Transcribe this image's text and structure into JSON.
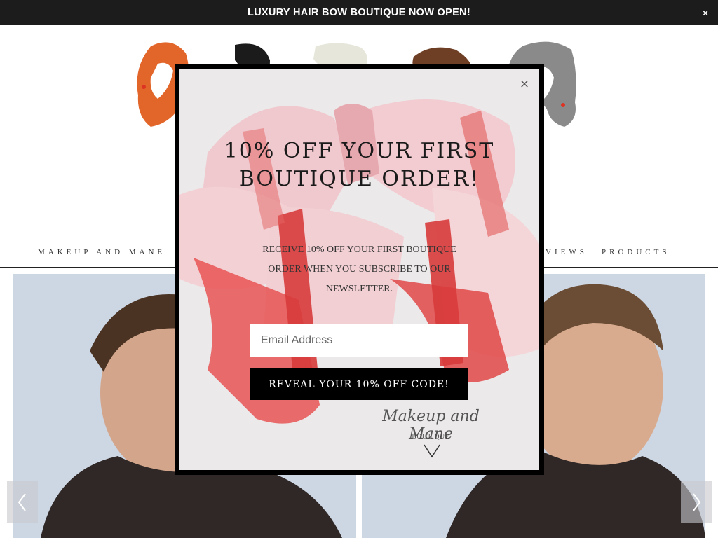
{
  "announcement": {
    "text": "LUXURY HAIR BOW BOUTIQUE NOW OPEN!",
    "close_label": "×"
  },
  "nav": {
    "items": [
      {
        "label": "MAKEUP AND MANE"
      },
      {
        "label": "REVIEWS"
      },
      {
        "label": "PRODUCTS"
      }
    ]
  },
  "popup": {
    "close_label": "×",
    "title": "10% OFF YOUR FIRST BOUTIQUE ORDER!",
    "text": "RECEIVE 10% OFF YOUR FIRST BOUTIQUE ORDER WHEN YOU SUBSCRIBE TO OUR NEWSLETTER.",
    "email_placeholder": "Email Address",
    "button_label": "REVEAL YOUR 10% OFF CODE!",
    "brand_name": "Makeup and Mane",
    "brand_sub": "BOUTIQUE"
  },
  "colors": {
    "announcement_bg": "#1c1c1c",
    "button_bg": "#000000",
    "bow_red": "#e03a3a",
    "bow_pink": "#f2c8cc"
  }
}
